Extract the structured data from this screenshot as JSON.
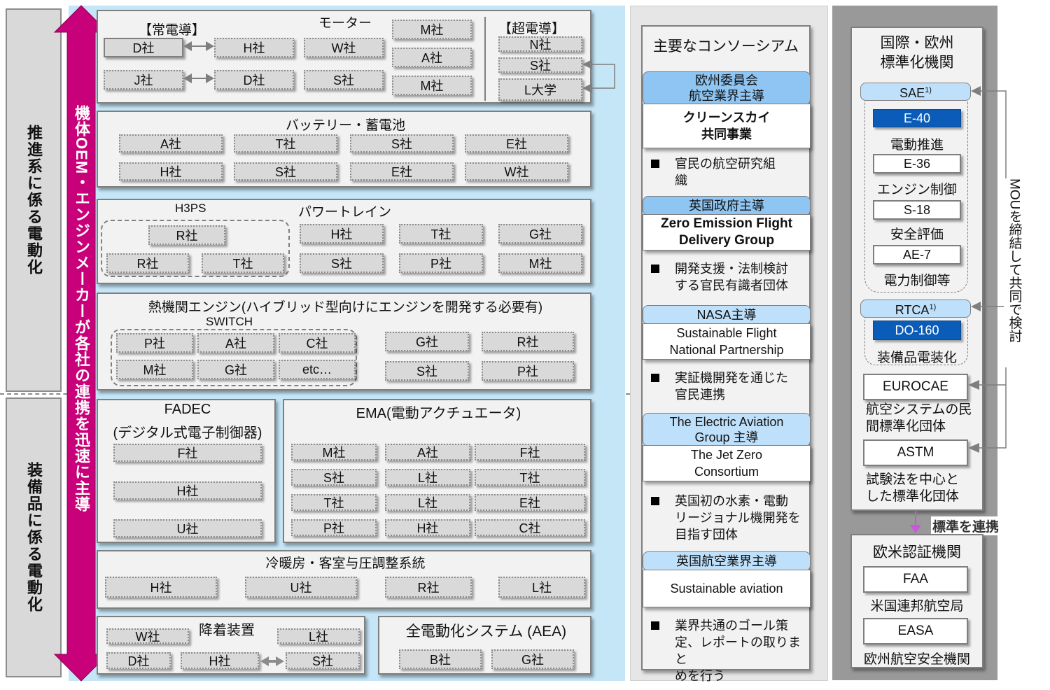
{
  "left_labels": {
    "propulsion": "推進系に係る電動化",
    "equipment": "装備品に係る電動化"
  },
  "arrow_label": "機体OEM・エンジンメーカーが各社の連携を迅速に主導",
  "colors": {
    "arrow": "#c8007a",
    "light_blue_bg": "#c5e6f7",
    "header_blue": "#8ec5f2",
    "standard_blue": "#0a5cb8"
  },
  "motor": {
    "title": "モーター",
    "normal_label": "【常電導】",
    "super_label": "【超電導】",
    "row1": [
      "D社",
      "H社",
      "W社"
    ],
    "row2": [
      "J社",
      "D社",
      "S社"
    ],
    "col_m": [
      "M社",
      "A社",
      "M社"
    ],
    "super": [
      "N社",
      "S社",
      "L大学"
    ]
  },
  "battery": {
    "title": "バッテリー・蓄電池",
    "row1": [
      "A社",
      "T社",
      "S社",
      "E社"
    ],
    "row2": [
      "H社",
      "S社",
      "E社",
      "W社"
    ]
  },
  "powertrain": {
    "title": "パワートレイン",
    "group_label": "H3PS",
    "group_top": "R社",
    "group_bottom": [
      "R社",
      "T社"
    ],
    "row1": [
      "H社",
      "T社",
      "G社"
    ],
    "row2": [
      "S社",
      "P社",
      "M社"
    ]
  },
  "heat_engine": {
    "title": "熱機関エンジン(ハイブリッド型向けにエンジンを開発する必要有)",
    "group_label": "SWITCH",
    "group_row1": [
      "P社",
      "A社",
      "C社"
    ],
    "group_row2": [
      "M社",
      "G社",
      "etc…"
    ],
    "row1": [
      "G社",
      "R社"
    ],
    "row2": [
      "S社",
      "P社"
    ]
  },
  "fadec": {
    "title1": "FADEC",
    "title2": "(デジタル式電子制御器)",
    "items": [
      "F社",
      "H社",
      "U社"
    ]
  },
  "ema": {
    "title": "EMA(電動アクチュエータ)",
    "rows": [
      [
        "M社",
        "A社",
        "F社"
      ],
      [
        "S社",
        "L社",
        "T社"
      ],
      [
        "T社",
        "L社",
        "E社"
      ],
      [
        "P社",
        "H社",
        "C社"
      ]
    ]
  },
  "hvac": {
    "title": "冷暖房・客室与圧調整系統",
    "items": [
      "H社",
      "U社",
      "R社",
      "L社"
    ]
  },
  "landing": {
    "title": "降着装置",
    "items": [
      "W社",
      "L社",
      "D社",
      "H社",
      "S社"
    ]
  },
  "aea": {
    "title": "全電動化システム (AEA)",
    "items": [
      "B社",
      "G社"
    ]
  },
  "consortium": {
    "title": "主要なコンソーシアム",
    "entries": [
      {
        "header": [
          "欧州委員会",
          "航空業界主導"
        ],
        "name": [
          "クリーンスカイ",
          "共同事業"
        ],
        "desc": [
          "官民の航空研究組",
          "織"
        ]
      },
      {
        "header": [
          "英国政府主導"
        ],
        "name": [
          "Zero Emission Flight",
          "Delivery Group"
        ],
        "desc": [
          "開発支援・法制検討",
          "する官民有識者団体"
        ]
      },
      {
        "header": [
          "NASA主導"
        ],
        "name": [
          "Sustainable Flight",
          "National Partnership"
        ],
        "desc": [
          "実証機開発を通じた",
          "官民連携"
        ]
      },
      {
        "header": [
          "The Electric Aviation",
          "Group 主導"
        ],
        "name": [
          "The Jet Zero",
          "Consortium"
        ],
        "desc": [
          "英国初の水素・電動",
          "リージョナル機開発を",
          "目指す団体"
        ]
      },
      {
        "header": [
          "英国航空業界主導"
        ],
        "name": [
          "Sustainable aviation"
        ],
        "desc": [
          "業界共通のゴール策",
          "定、レポートの取りまと",
          "めを行う"
        ]
      }
    ]
  },
  "standards": {
    "title": [
      "国際・欧州",
      "標準化機関"
    ],
    "sae": {
      "label": "SAE",
      "sup": "1)"
    },
    "sae_items": [
      {
        "code": "E-40",
        "desc": "電動推進"
      },
      {
        "code": "E-36",
        "desc": "エンジン制御"
      },
      {
        "code": "S-18",
        "desc": "安全評価"
      },
      {
        "code": "AE-7",
        "desc": "電力制御等"
      }
    ],
    "rtca": {
      "label": "RTCA",
      "sup": "1)"
    },
    "rtca_item": {
      "code": "DO-160",
      "desc": "装備品電装化"
    },
    "eurocae": {
      "label": "EUROCAE",
      "desc": [
        "航空システムの民",
        "間標準化団体"
      ]
    },
    "astm": {
      "label": "ASTM",
      "desc": [
        "試験法を中心と",
        "した標準化団体"
      ]
    },
    "mou_label": "MOUを締結して共同で検討",
    "link_label": "標準を連携"
  },
  "certification": {
    "title": "欧米認証機関",
    "items": [
      {
        "code": "FAA",
        "desc": "米国連邦航空局"
      },
      {
        "code": "EASA",
        "desc": "欧州航空安全機関"
      }
    ]
  }
}
